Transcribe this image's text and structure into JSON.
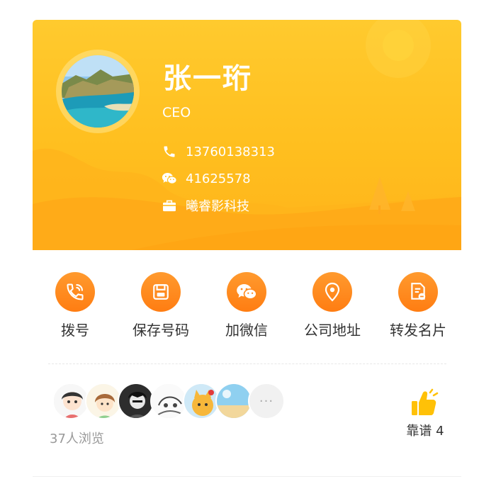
{
  "profile": {
    "name": "张一珩",
    "title": "CEO",
    "phone": "13760138313",
    "wechat": "41625578",
    "company": "曦睿影科技"
  },
  "actions": [
    {
      "label": "拨号",
      "icon": "phone-icon"
    },
    {
      "label": "保存号码",
      "icon": "save-icon"
    },
    {
      "label": "加微信",
      "icon": "wechat-icon"
    },
    {
      "label": "公司地址",
      "icon": "location-pin-icon"
    },
    {
      "label": "转发名片",
      "icon": "forward-card-icon"
    }
  ],
  "viewers": {
    "count_text": "37人浏览",
    "more_label": "···"
  },
  "like": {
    "label": "靠谱 4",
    "icon": "thumbs-up-icon"
  },
  "colors": {
    "header_yellow": "#ffc12a",
    "action_orange": "#ff8a1c",
    "like_yellow": "#ffc107"
  }
}
